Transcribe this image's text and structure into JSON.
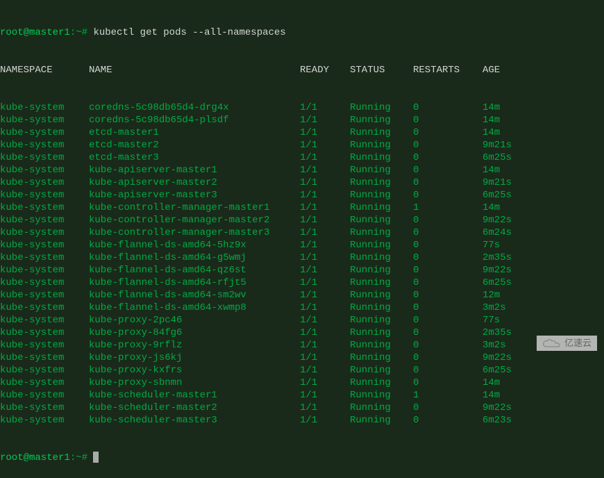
{
  "prompt": {
    "user_host": "root@master1",
    "path": "~",
    "symbol": "#",
    "command": "kubectl get pods --all-namespaces"
  },
  "headers": {
    "namespace": "NAMESPACE",
    "name": "NAME",
    "ready": "READY",
    "status": "STATUS",
    "restarts": "RESTARTS",
    "age": "AGE"
  },
  "rows": [
    {
      "ns": "kube-system",
      "name": "coredns-5c98db65d4-drg4x",
      "ready": "1/1",
      "status": "Running",
      "restarts": "0",
      "age": "14m"
    },
    {
      "ns": "kube-system",
      "name": "coredns-5c98db65d4-plsdf",
      "ready": "1/1",
      "status": "Running",
      "restarts": "0",
      "age": "14m"
    },
    {
      "ns": "kube-system",
      "name": "etcd-master1",
      "ready": "1/1",
      "status": "Running",
      "restarts": "0",
      "age": "14m"
    },
    {
      "ns": "kube-system",
      "name": "etcd-master2",
      "ready": "1/1",
      "status": "Running",
      "restarts": "0",
      "age": "9m21s"
    },
    {
      "ns": "kube-system",
      "name": "etcd-master3",
      "ready": "1/1",
      "status": "Running",
      "restarts": "0",
      "age": "6m25s"
    },
    {
      "ns": "kube-system",
      "name": "kube-apiserver-master1",
      "ready": "1/1",
      "status": "Running",
      "restarts": "0",
      "age": "14m"
    },
    {
      "ns": "kube-system",
      "name": "kube-apiserver-master2",
      "ready": "1/1",
      "status": "Running",
      "restarts": "0",
      "age": "9m21s"
    },
    {
      "ns": "kube-system",
      "name": "kube-apiserver-master3",
      "ready": "1/1",
      "status": "Running",
      "restarts": "0",
      "age": "6m25s"
    },
    {
      "ns": "kube-system",
      "name": "kube-controller-manager-master1",
      "ready": "1/1",
      "status": "Running",
      "restarts": "1",
      "age": "14m"
    },
    {
      "ns": "kube-system",
      "name": "kube-controller-manager-master2",
      "ready": "1/1",
      "status": "Running",
      "restarts": "0",
      "age": "9m22s"
    },
    {
      "ns": "kube-system",
      "name": "kube-controller-manager-master3",
      "ready": "1/1",
      "status": "Running",
      "restarts": "0",
      "age": "6m24s"
    },
    {
      "ns": "kube-system",
      "name": "kube-flannel-ds-amd64-5hz9x",
      "ready": "1/1",
      "status": "Running",
      "restarts": "0",
      "age": "77s"
    },
    {
      "ns": "kube-system",
      "name": "kube-flannel-ds-amd64-g5wmj",
      "ready": "1/1",
      "status": "Running",
      "restarts": "0",
      "age": "2m35s"
    },
    {
      "ns": "kube-system",
      "name": "kube-flannel-ds-amd64-qz6st",
      "ready": "1/1",
      "status": "Running",
      "restarts": "0",
      "age": "9m22s"
    },
    {
      "ns": "kube-system",
      "name": "kube-flannel-ds-amd64-rfjt5",
      "ready": "1/1",
      "status": "Running",
      "restarts": "0",
      "age": "6m25s"
    },
    {
      "ns": "kube-system",
      "name": "kube-flannel-ds-amd64-sm2wv",
      "ready": "1/1",
      "status": "Running",
      "restarts": "0",
      "age": "12m"
    },
    {
      "ns": "kube-system",
      "name": "kube-flannel-ds-amd64-xwmp8",
      "ready": "1/1",
      "status": "Running",
      "restarts": "0",
      "age": "3m2s"
    },
    {
      "ns": "kube-system",
      "name": "kube-proxy-2pc46",
      "ready": "1/1",
      "status": "Running",
      "restarts": "0",
      "age": "77s"
    },
    {
      "ns": "kube-system",
      "name": "kube-proxy-84fg6",
      "ready": "1/1",
      "status": "Running",
      "restarts": "0",
      "age": "2m35s"
    },
    {
      "ns": "kube-system",
      "name": "kube-proxy-9rflz",
      "ready": "1/1",
      "status": "Running",
      "restarts": "0",
      "age": "3m2s"
    },
    {
      "ns": "kube-system",
      "name": "kube-proxy-js6kj",
      "ready": "1/1",
      "status": "Running",
      "restarts": "0",
      "age": "9m22s"
    },
    {
      "ns": "kube-system",
      "name": "kube-proxy-kxfrs",
      "ready": "1/1",
      "status": "Running",
      "restarts": "0",
      "age": "6m25s"
    },
    {
      "ns": "kube-system",
      "name": "kube-proxy-sbnmn",
      "ready": "1/1",
      "status": "Running",
      "restarts": "0",
      "age": "14m"
    },
    {
      "ns": "kube-system",
      "name": "kube-scheduler-master1",
      "ready": "1/1",
      "status": "Running",
      "restarts": "1",
      "age": "14m"
    },
    {
      "ns": "kube-system",
      "name": "kube-scheduler-master2",
      "ready": "1/1",
      "status": "Running",
      "restarts": "0",
      "age": "9m22s"
    },
    {
      "ns": "kube-system",
      "name": "kube-scheduler-master3",
      "ready": "1/1",
      "status": "Running",
      "restarts": "0",
      "age": "6m23s"
    }
  ],
  "watermark": {
    "text": "亿速云"
  }
}
